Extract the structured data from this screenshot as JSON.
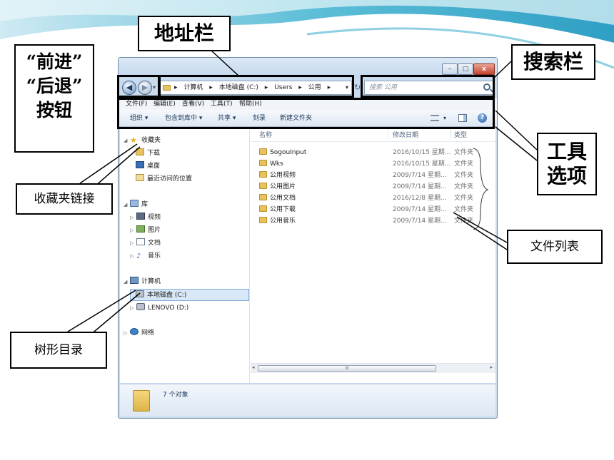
{
  "colors": {
    "accent_teal": "#3fa9c9",
    "window_frame": "#c9dcee",
    "highlight": "#d9e8f7"
  },
  "annotations": {
    "address_bar": "地址栏",
    "nav_buttons": [
      "“前进”",
      "“后退”",
      "按钮"
    ],
    "search_bar": "搜索栏",
    "toolbar_options": [
      "工具",
      "选项"
    ],
    "favorites_link": "收藏夹链接",
    "file_list": "文件列表",
    "tree_directory": "树形目录"
  },
  "window": {
    "caption_buttons": {
      "minimize": "–",
      "maximize": "□",
      "close": "x"
    },
    "nav": {
      "back": "◀",
      "forward": "▶",
      "dropdown": "▾"
    },
    "address_path": [
      "▸",
      "计算机",
      "▸",
      "本地磁盘 (C:)",
      "▸",
      "Users",
      "▸",
      "公用",
      "▸"
    ],
    "address_dropdown": "▾",
    "refresh": "↻",
    "search_placeholder": "搜索 公用",
    "menu": [
      "文件(F)",
      "编辑(E)",
      "查看(V)",
      "工具(T)",
      "帮助(H)"
    ],
    "toolbar": [
      "组织 ▾",
      "包含到库中 ▾",
      "共享 ▾",
      "刻录",
      "新建文件夹"
    ],
    "help_label": "?",
    "view_dropdown": "▾",
    "nav_pane": {
      "favorites": {
        "label": "收藏夹",
        "items": [
          "下载",
          "桌面",
          "最近访问的位置"
        ]
      },
      "libraries": {
        "label": "库",
        "items": [
          "视频",
          "图片",
          "文档",
          "音乐"
        ]
      },
      "computer": {
        "label": "计算机",
        "items": [
          "本地磁盘 (C:)",
          "LENOVO (D:)"
        ]
      },
      "network": {
        "label": "网络"
      }
    },
    "columns": {
      "name": "名称",
      "date": "修改日期",
      "type": "类型"
    },
    "files": [
      {
        "name": "SogouInput",
        "date": "2016/10/15 星期...",
        "type": "文件夹"
      },
      {
        "name": "Wks",
        "date": "2016/10/15 星期...",
        "type": "文件夹"
      },
      {
        "name": "公用视频",
        "date": "2009/7/14 星期...",
        "type": "文件夹"
      },
      {
        "name": "公用图片",
        "date": "2009/7/14 星期...",
        "type": "文件夹"
      },
      {
        "name": "公用文档",
        "date": "2016/12/8 星期...",
        "type": "文件夹"
      },
      {
        "name": "公用下载",
        "date": "2009/7/14 星期...",
        "type": "文件夹"
      },
      {
        "name": "公用音乐",
        "date": "2009/7/14 星期...",
        "type": "文件夹"
      }
    ],
    "scroll_grip": "III",
    "scroll_left": "◂",
    "scroll_right": "▸",
    "status": "7 个对象"
  }
}
